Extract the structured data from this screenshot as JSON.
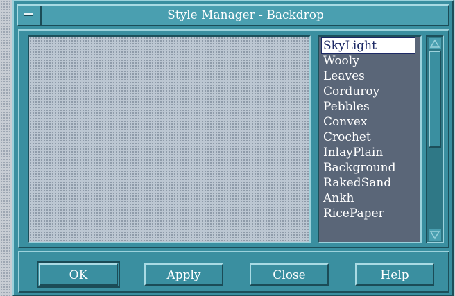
{
  "window": {
    "title": "Style Manager - Backdrop"
  },
  "backdrop_list": {
    "selected": "SkyLight",
    "items": [
      "SkyLight",
      "Wooly",
      "Leaves",
      "Corduroy",
      "Pebbles",
      "Convex",
      "Crochet",
      "InlayPlain",
      "Background",
      "RakedSand",
      "Ankh",
      "RicePaper"
    ]
  },
  "buttons": {
    "ok": "OK",
    "apply": "Apply",
    "close": "Close",
    "help": "Help"
  },
  "colors": {
    "window_bg": "#3a8fa0",
    "list_bg": "#5a6678",
    "preview_bg": "#bcc7d2"
  }
}
